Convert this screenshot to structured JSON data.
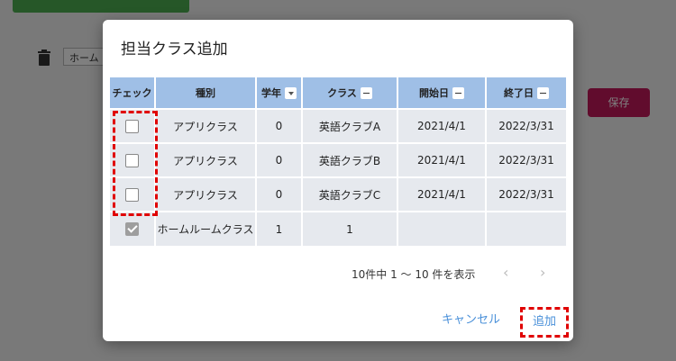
{
  "background": {
    "select_text": "ホーム",
    "save_label": "保存"
  },
  "dialog": {
    "title": "担当クラス追加",
    "columns": {
      "check": "チェック",
      "type": "種別",
      "grade": "学年",
      "class": "クラス",
      "start": "開始日",
      "end": "終了日"
    },
    "rows": [
      {
        "checked": false,
        "type": "アプリクラス",
        "grade": "0",
        "class": "英語クラブA",
        "start": "2021/4/1",
        "end": "2022/3/31"
      },
      {
        "checked": false,
        "type": "アプリクラス",
        "grade": "0",
        "class": "英語クラブB",
        "start": "2021/4/1",
        "end": "2022/3/31"
      },
      {
        "checked": false,
        "type": "アプリクラス",
        "grade": "0",
        "class": "英語クラブC",
        "start": "2021/4/1",
        "end": "2022/3/31"
      },
      {
        "checked": true,
        "type": "ホームルームクラス",
        "grade": "1",
        "class": "1",
        "start": "",
        "end": ""
      }
    ],
    "pagination_text": "10件中 1 〜 10 件を表示",
    "prev": "‹",
    "next": "›",
    "cancel_label": "キャンセル",
    "add_label": "追加"
  }
}
